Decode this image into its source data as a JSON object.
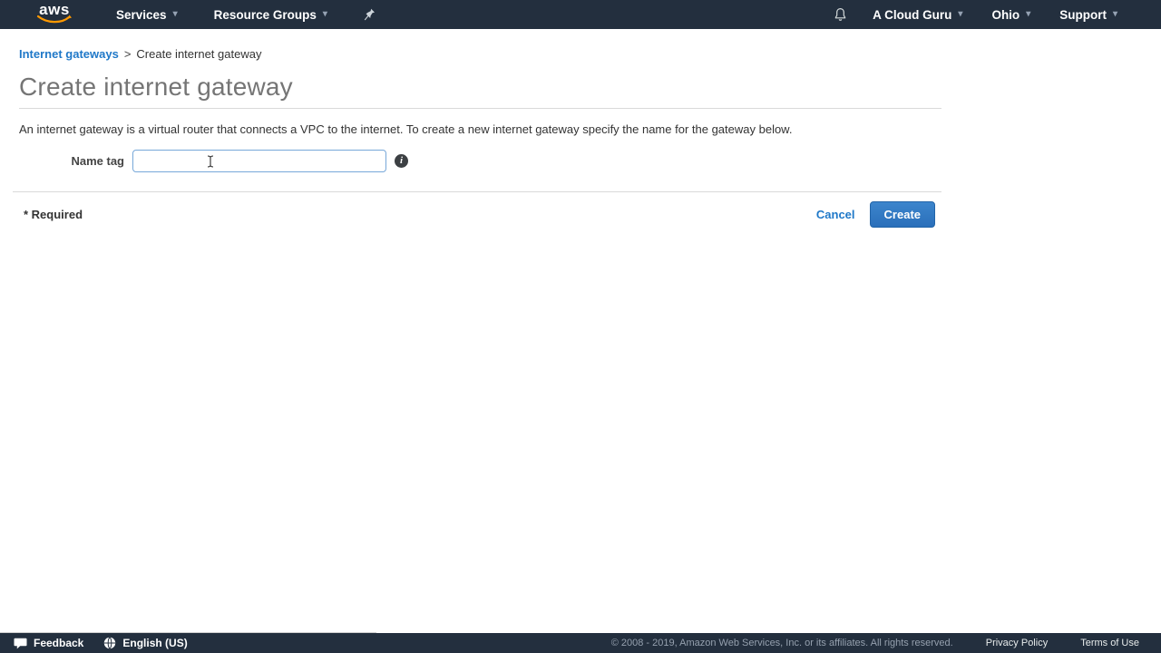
{
  "nav": {
    "logo_text": "aws",
    "services_label": "Services",
    "resource_groups_label": "Resource Groups",
    "account_label": "A Cloud Guru",
    "region_label": "Ohio",
    "support_label": "Support",
    "caret": "▾"
  },
  "breadcrumb": {
    "link": "Internet gateways",
    "separator": ">",
    "current": "Create internet gateway"
  },
  "page": {
    "title": "Create internet gateway",
    "description": "An internet gateway is a virtual router that connects a VPC to the internet. To create a new internet gateway specify the name for the gateway below."
  },
  "form": {
    "name_tag_label": "Name tag",
    "name_tag_value": "",
    "required_note": "* Required"
  },
  "actions": {
    "cancel_label": "Cancel",
    "create_label": "Create"
  },
  "footer": {
    "feedback_label": "Feedback",
    "language_label": "English (US)",
    "copyright": "© 2008 - 2019, Amazon Web Services, Inc. or its affiliates. All rights reserved.",
    "privacy_label": "Privacy Policy",
    "terms_label": "Terms of Use"
  },
  "colors": {
    "navbar_bg": "#232f3e",
    "link_blue": "#1f78c8",
    "create_button_blue": "#2a6fba",
    "logo_smile_orange": "#ff9900",
    "title_gray": "#757575"
  }
}
